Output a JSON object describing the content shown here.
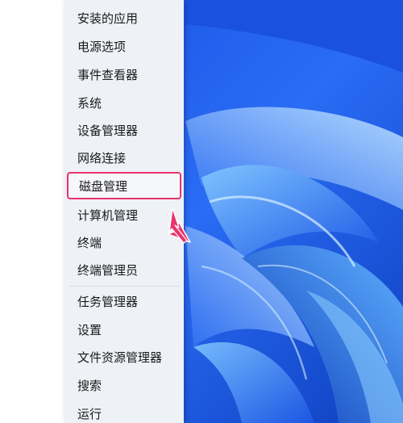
{
  "menu": {
    "items": [
      {
        "label": "安装的应用"
      },
      {
        "label": "电源选项"
      },
      {
        "label": "事件查看器"
      },
      {
        "label": "系统"
      },
      {
        "label": "设备管理器"
      },
      {
        "label": "网络连接"
      },
      {
        "label": "磁盘管理",
        "highlighted": true
      },
      {
        "label": "计算机管理"
      },
      {
        "label": "终端"
      },
      {
        "label": "终端管理员"
      },
      {
        "label": "任务管理器"
      },
      {
        "label": "设置"
      },
      {
        "label": "文件资源管理器"
      },
      {
        "label": "搜索"
      },
      {
        "label": "运行"
      }
    ]
  },
  "colors": {
    "highlight_border": "#e8336b",
    "arrow": "#e8336b",
    "wallpaper_primary": "#1f5ce8",
    "wallpaper_light": "#4aa3ff"
  },
  "icons": {
    "pointer_arrow": "arrow-icon"
  }
}
